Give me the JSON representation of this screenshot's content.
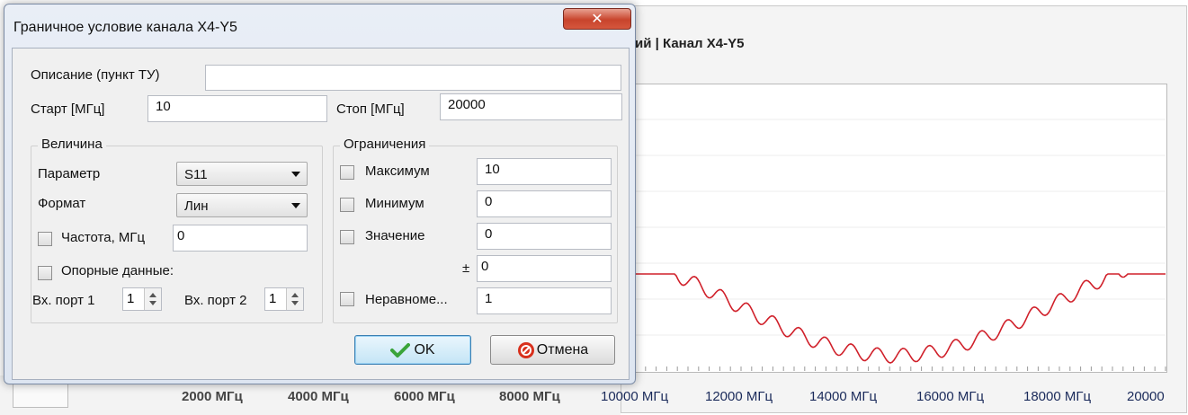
{
  "background": {
    "chart_title": "ий | Канал X4-Y5",
    "x_tick_labels": [
      "2000 МГц",
      "4000 МГц",
      "6000 МГц",
      "8000 МГц",
      "10000 МГц",
      "12000 МГц",
      "14000 МГц",
      "16000 МГц",
      "18000 МГц",
      "20000"
    ]
  },
  "dialog": {
    "title": "Граничное условие канала X4-Y5",
    "close_glyph": "✕",
    "description_label": "Описание (пункт ТУ)",
    "description_value": "",
    "start_label": "Старт [МГц]",
    "start_value": "10",
    "stop_label": "Стоп [МГц]",
    "stop_value": "20000",
    "quantity_group": {
      "title": "Величина",
      "parameter_label": "Параметр",
      "parameter_value": "S11",
      "format_label": "Формат",
      "format_value": "Лин",
      "frequency_label": "Частота, МГц",
      "frequency_value": "0",
      "reference_label": "Опорные данные:",
      "port1_label": "Вх. порт 1",
      "port1_value": "1",
      "port2_label": "Вх. порт 2",
      "port2_value": "1"
    },
    "limits_group": {
      "title": "Ограничения",
      "max_label": "Максимум",
      "max_value": "10",
      "min_label": "Минимум",
      "min_value": "0",
      "value_label": "Значение",
      "value_value": "0",
      "tolerance_label": "±",
      "tolerance_value": "0",
      "ripple_label": "Неравноме...",
      "ripple_value": "1"
    },
    "ok_label": "OK",
    "cancel_label": "Отмена"
  },
  "colors": {
    "trace": "#d0202a",
    "ok_icon": "#3aa43a",
    "cancel_icon": "#d8301c"
  },
  "icons": {
    "ok": "checkmark-icon",
    "cancel": "no-entry-icon"
  }
}
